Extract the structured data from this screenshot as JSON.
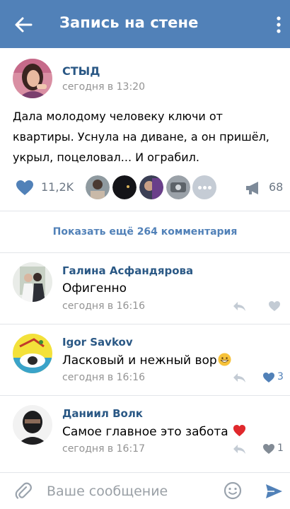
{
  "header": {
    "title": "Запись на стене",
    "back_icon": "arrow-left-icon",
    "menu_icon": "more-vertical-icon",
    "color": "#5181b8"
  },
  "post": {
    "author": "СТЫД",
    "time": "сегодня в 13:20",
    "text": "Дала молодому человеку ключи от квартиры. Уснула на диване, а он пришёл, укрыл, поцеловал... И ограбил.",
    "likes": "11,2K",
    "shares": "68",
    "like_icon": "heart-icon",
    "share_icon": "megaphone-icon"
  },
  "comments_link": "Показать ещё 264 комментария",
  "comments": [
    {
      "name": "Галина Асфандярова",
      "text": "Офигенно",
      "time": "сегодня в 16:16",
      "likes": "",
      "liked": false
    },
    {
      "name": "Igor Savkov",
      "text": "Ласковый и нежный вор",
      "emoji": "grinning-face-emoji",
      "time": "сегодня в 16:16",
      "likes": "3",
      "liked": true
    },
    {
      "name": "Даниил Волк",
      "text": "Самое главное это забота",
      "emoji": "red-heart-emoji",
      "time": "сегодня в 16:17",
      "likes": "1",
      "liked": false
    }
  ],
  "composer": {
    "placeholder": "Ваше сообщение",
    "attach_icon": "paperclip-icon",
    "emoji_icon": "smile-icon",
    "send_icon": "send-icon"
  }
}
